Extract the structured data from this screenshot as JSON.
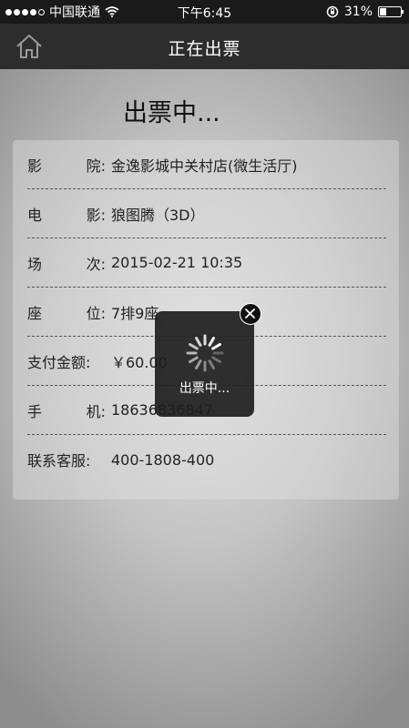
{
  "status_bar": {
    "carrier": "中国联通",
    "time": "下午6:45",
    "battery": "31%",
    "battery_level": 0.31
  },
  "nav": {
    "title": "正在出票",
    "home_icon": "home-icon"
  },
  "heading": "出票中...",
  "details": [
    {
      "label_chars": [
        "影",
        "院:"
      ],
      "value": "金逸影城中关村店(微生活厅)"
    },
    {
      "label_chars": [
        "电",
        "影:"
      ],
      "value": "狼图腾（3D）"
    },
    {
      "label_chars": [
        "场",
        "次:"
      ],
      "value": "2015-02-21 10:35"
    },
    {
      "label_chars": [
        "座",
        "位:"
      ],
      "value": "7排9座"
    },
    {
      "label_chars": [
        "支付金额:"
      ],
      "value": "￥60.00"
    },
    {
      "label_chars": [
        "手",
        "机:"
      ],
      "value": "18636836847"
    },
    {
      "label_chars": [
        "联系客服:"
      ],
      "value": "400-1808-400"
    }
  ],
  "loader": {
    "text": "出票中...",
    "close_icon": "close-icon"
  }
}
